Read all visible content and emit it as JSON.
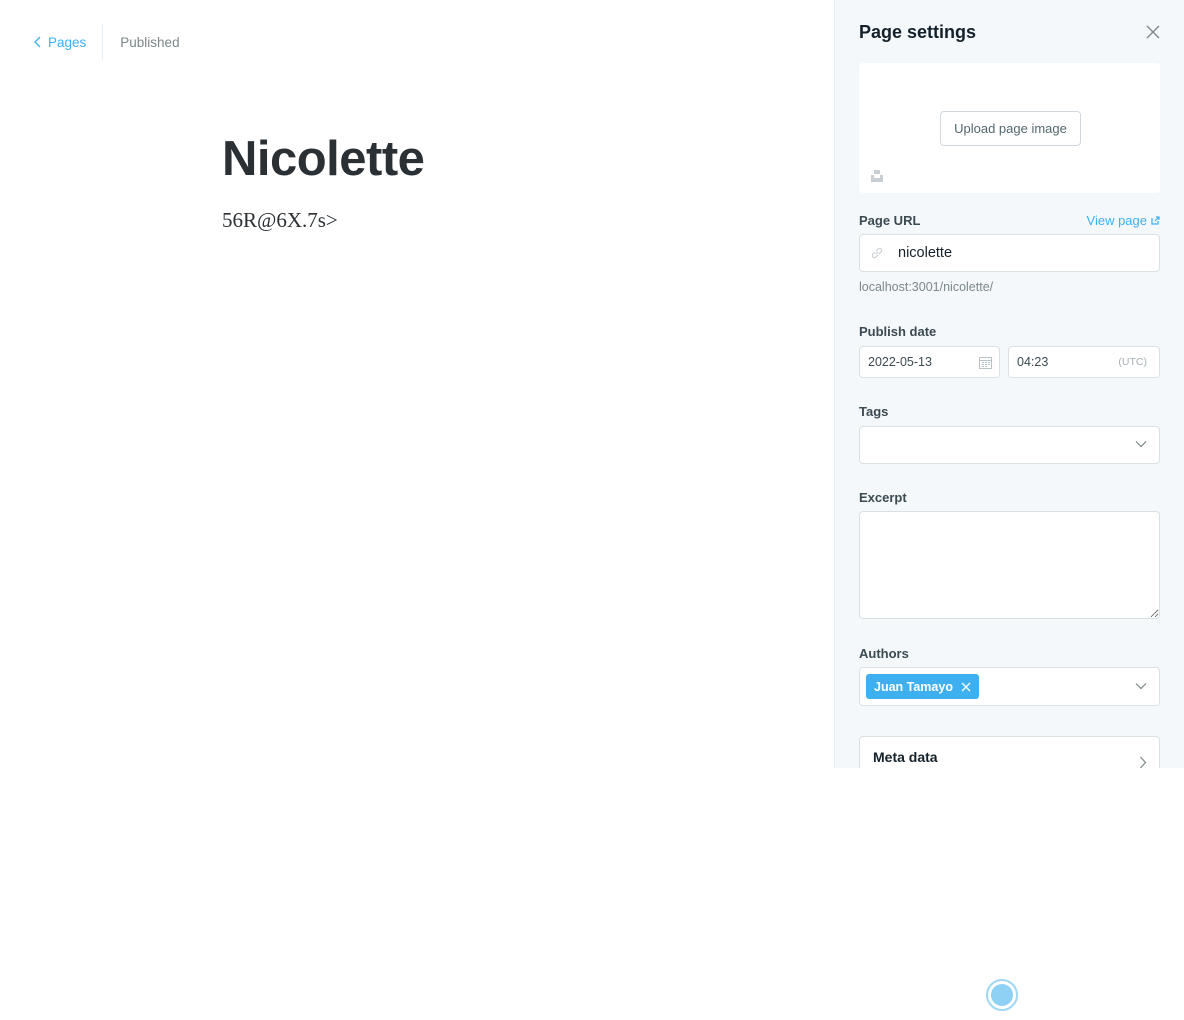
{
  "breadcrumb": {
    "back_label": "Pages",
    "status": "Published"
  },
  "editor": {
    "title": "Nicolette",
    "body": "56R@6X.7s>"
  },
  "settings": {
    "title": "Page settings",
    "upload_label": "Upload page image",
    "url": {
      "label": "Page URL",
      "view_page": "View page",
      "value": "nicolette",
      "hint": "localhost:3001/nicolette/"
    },
    "publish": {
      "label": "Publish date",
      "date": "2022-05-13",
      "time": "04:23",
      "timezone": "(UTC)"
    },
    "tags": {
      "label": "Tags"
    },
    "excerpt": {
      "label": "Excerpt",
      "value": ""
    },
    "authors": {
      "label": "Authors",
      "items": [
        "Juan Tamayo"
      ]
    },
    "meta": {
      "label": "Meta data"
    }
  },
  "colors": {
    "accent": "#3eb0ef",
    "panel_bg": "#f4f8fb",
    "text_dark": "#15212a",
    "text_muted": "#7d878a"
  },
  "icons": {
    "back": "chevron-left-icon",
    "close": "close-icon",
    "unsplash": "unsplash-icon",
    "link": "link-icon",
    "external": "external-link-icon",
    "calendar": "calendar-icon",
    "dropdown": "chevron-down-icon",
    "remove": "close-icon",
    "expand": "chevron-right-icon"
  }
}
